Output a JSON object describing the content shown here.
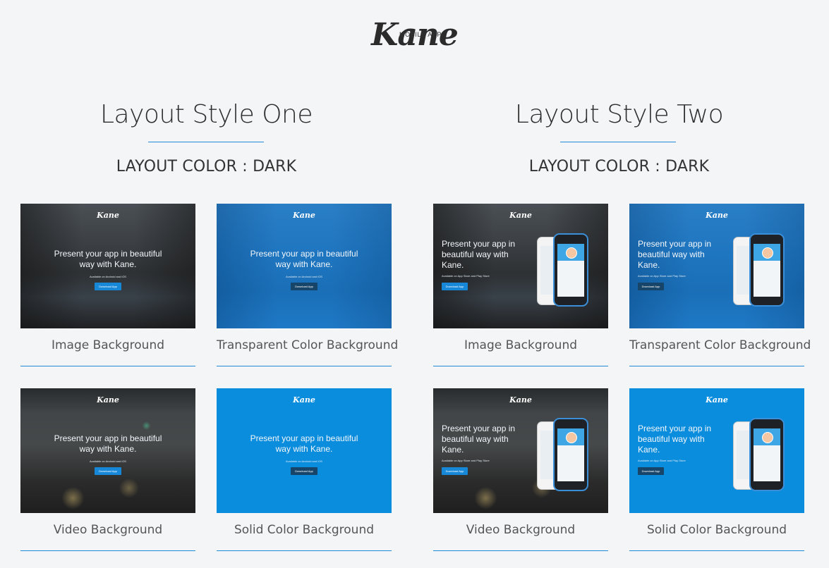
{
  "brand": {
    "name": "Kane",
    "tagline": "MOBILE APP"
  },
  "thumbnail_text": {
    "logo": "Kane",
    "headline_line1": "Present your app in beautiful",
    "headline_line2": "way with Kane.",
    "headline2_line1": "Present your app in",
    "headline2_line2": "beautiful way with",
    "headline2_line3": "Kane.",
    "note": "Available on Android and iOS",
    "note2": "Available on App Store and Play Store",
    "button": "Download App"
  },
  "layouts": [
    {
      "title": "Layout Style One",
      "subtitle": "LAYOUT COLOR : DARK",
      "cards": [
        {
          "label": "Image Background",
          "style": "image"
        },
        {
          "label": "Transparent Color Background",
          "style": "transparent"
        },
        {
          "label": "Video Background",
          "style": "video"
        },
        {
          "label": "Solid Color Background",
          "style": "solid"
        }
      ]
    },
    {
      "title": "Layout Style Two",
      "subtitle": "LAYOUT COLOR : DARK",
      "cards": [
        {
          "label": "Image Background",
          "style": "image"
        },
        {
          "label": "Transparent Color Background",
          "style": "transparent"
        },
        {
          "label": "Video Background",
          "style": "video"
        },
        {
          "label": "Solid Color Background",
          "style": "solid"
        }
      ]
    }
  ],
  "colors": {
    "accent": "#1f8bd6",
    "solid_blue": "#0b8dde",
    "background": "#f4f5f7"
  }
}
